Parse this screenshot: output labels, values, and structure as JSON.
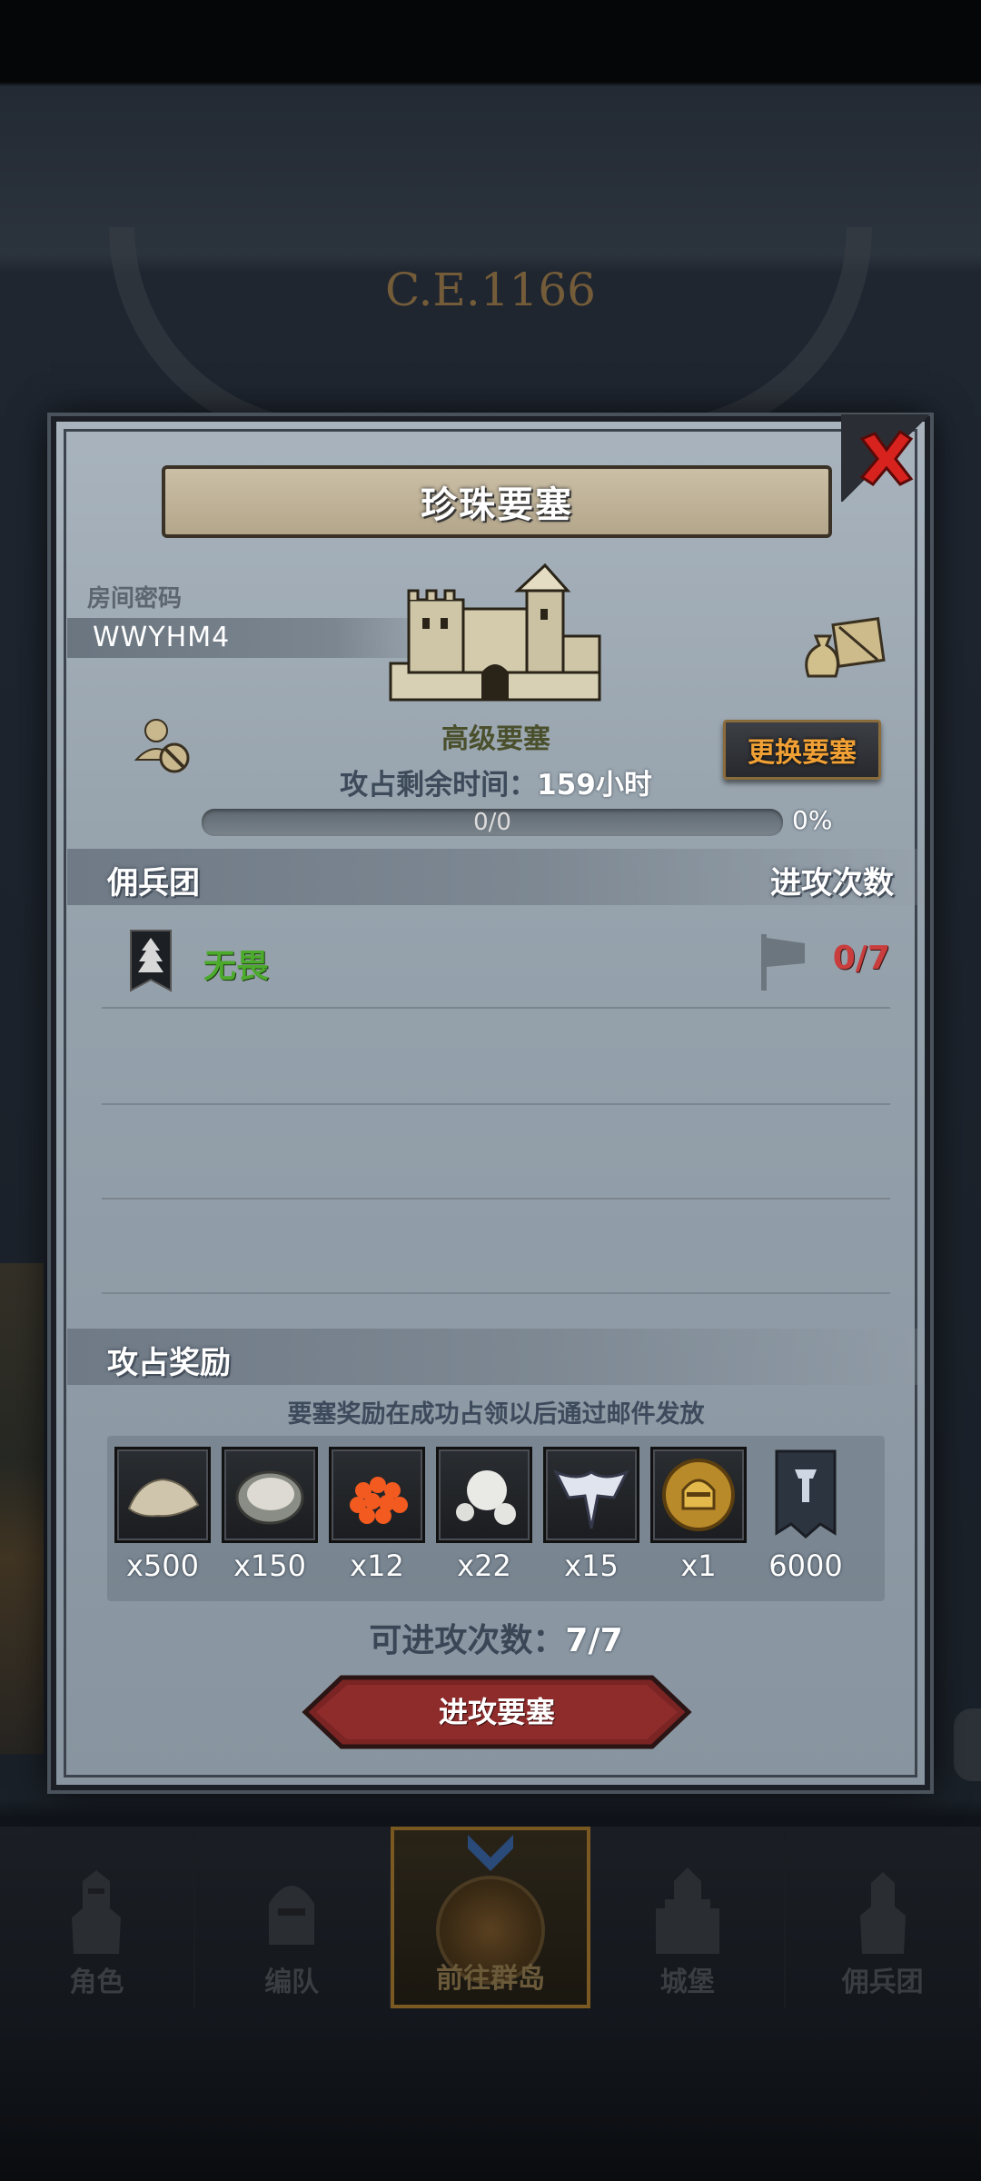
{
  "background": {
    "year": "C.E.1166"
  },
  "modal": {
    "title": "珍珠要塞",
    "room_label": "房间密码",
    "room_code": "WWYHM4",
    "fortress_level": "高级要塞",
    "time_left_label": "攻占剩余时间：",
    "time_left_value": "159小时",
    "progress_text": "0/0",
    "progress_percent": "0%",
    "progress_fraction": 0,
    "change_button": "更换要塞",
    "mercenary_header": "佣兵团",
    "attacks_header": "进攻次数",
    "mercenaries": [
      {
        "name": "无畏",
        "attacks": "0/7"
      }
    ],
    "rewards_header": "攻占奖励",
    "reward_note": "要塞奖励在成功占领以后通过邮件发放",
    "rewards": [
      {
        "icon": "sand-icon",
        "qty": "x500"
      },
      {
        "icon": "oyster-icon",
        "qty": "x150"
      },
      {
        "icon": "roe-icon",
        "qty": "x12"
      },
      {
        "icon": "pearl-icon",
        "qty": "x22"
      },
      {
        "icon": "emblem-icon",
        "qty": "x15"
      },
      {
        "icon": "helmet-coin-icon",
        "qty": "x1"
      },
      {
        "icon": "banner-icon",
        "qty": "6000"
      }
    ],
    "attack_count_label": "可进攻次数：",
    "attack_count_value": "7/7",
    "attack_button": "进攻要塞"
  },
  "bottom_nav": {
    "items": [
      {
        "label": "角色"
      },
      {
        "label": "编队"
      },
      {
        "label": "前往群岛"
      },
      {
        "label": "城堡"
      },
      {
        "label": "佣兵团"
      }
    ]
  },
  "colors": {
    "accent_orange": "#f0a035",
    "green_name": "#4caa2c",
    "red_count": "#c93d3d"
  }
}
